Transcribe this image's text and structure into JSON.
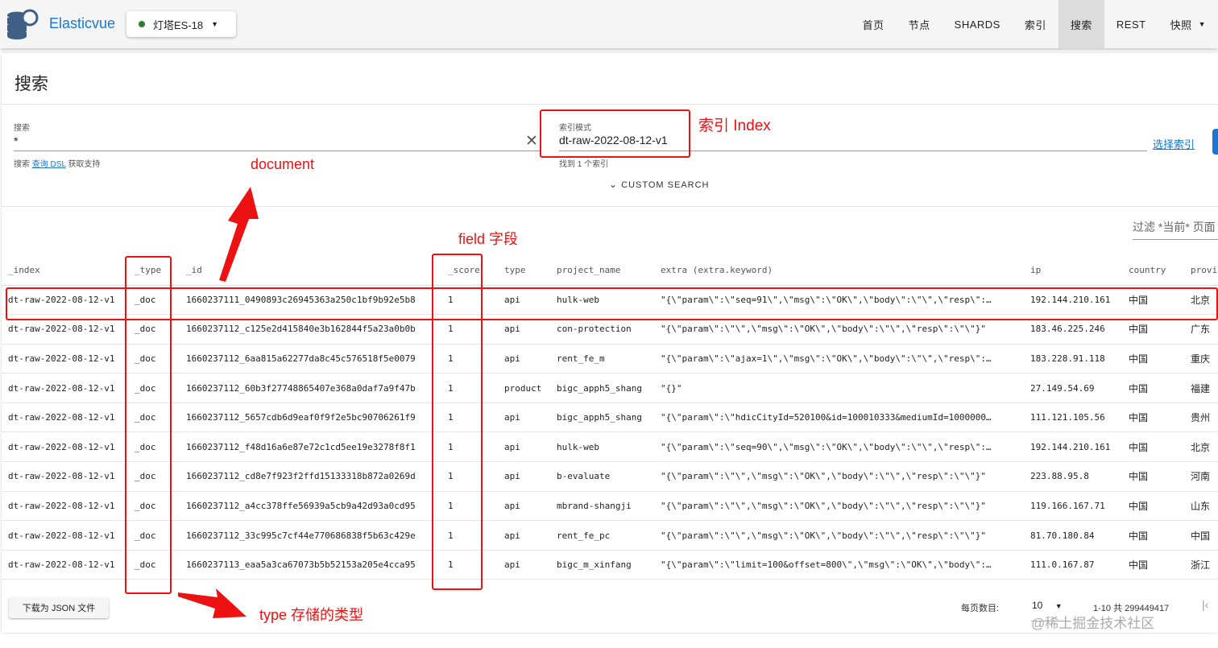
{
  "app": {
    "brand": "Elasticvue",
    "cluster": "灯塔ES-18"
  },
  "nav": [
    "首页",
    "节点",
    "SHARDS",
    "索引",
    "搜索",
    "REST",
    "快照"
  ],
  "page": {
    "title": "搜索"
  },
  "search": {
    "label": "搜索",
    "value": "*",
    "hint_prefix": "搜索",
    "hint_link": "查询 DSL",
    "hint_suffix": "获取支持",
    "index_label": "索引模式",
    "index_value": "dt-raw-2022-08-12-v1",
    "index_hint": "找到 1 个索引",
    "select_index": "选择索引",
    "custom_search": "CUSTOM SEARCH",
    "filter_placeholder": "过滤 *当前* 页面"
  },
  "table": {
    "columns": [
      "_index",
      "_type",
      "_id",
      "_score",
      "type",
      "project_name",
      "extra (extra.keyword)",
      "ip",
      "country",
      "province"
    ],
    "rows": [
      [
        "dt-raw-2022-08-12-v1",
        "_doc",
        "1660237111_0490893c26945363a250c1bf9b92e5b8",
        "1",
        "api",
        "hulk-web",
        "\"{\\\"param\\\":\\\"seq=91\\\",\\\"msg\\\":\\\"OK\\\",\\\"body\\\":\\\"\\\",\\\"resp\\\":…",
        "192.144.210.161",
        "中国",
        "北京"
      ],
      [
        "dt-raw-2022-08-12-v1",
        "_doc",
        "1660237112_c125e2d415840e3b162844f5a23a0b0b",
        "1",
        "api",
        "con-protection",
        "\"{\\\"param\\\":\\\"\\\",\\\"msg\\\":\\\"OK\\\",\\\"body\\\":\\\"\\\",\\\"resp\\\":\\\"\\\"}\"",
        "183.46.225.246",
        "中国",
        "广东"
      ],
      [
        "dt-raw-2022-08-12-v1",
        "_doc",
        "1660237112_6aa815a62277da8c45c576518f5e0079",
        "1",
        "api",
        "rent_fe_m",
        "\"{\\\"param\\\":\\\"ajax=1\\\",\\\"msg\\\":\\\"OK\\\",\\\"body\\\":\\\"\\\",\\\"resp\\\":…",
        "183.228.91.118",
        "中国",
        "重庆"
      ],
      [
        "dt-raw-2022-08-12-v1",
        "_doc",
        "1660237112_60b3f27748865407e368a0daf7a9f47b",
        "1",
        "product",
        "bigc_apph5_shang",
        "\"{}\"",
        "27.149.54.69",
        "中国",
        "福建"
      ],
      [
        "dt-raw-2022-08-12-v1",
        "_doc",
        "1660237112_5657cdb6d9eaf0f9f2e5bc90706261f9",
        "1",
        "api",
        "bigc_apph5_shang",
        "\"{\\\"param\\\":\\\"hdicCityId=520100&id=100010333&mediumId=1000000…",
        "111.121.105.56",
        "中国",
        "贵州"
      ],
      [
        "dt-raw-2022-08-12-v1",
        "_doc",
        "1660237112_f48d16a6e87e72c1cd5ee19e3278f8f1",
        "1",
        "api",
        "hulk-web",
        "\"{\\\"param\\\":\\\"seq=90\\\",\\\"msg\\\":\\\"OK\\\",\\\"body\\\":\\\"\\\",\\\"resp\\\":…",
        "192.144.210.161",
        "中国",
        "北京"
      ],
      [
        "dt-raw-2022-08-12-v1",
        "_doc",
        "1660237112_cd8e7f923f2ffd15133318b872a0269d",
        "1",
        "api",
        "b-evaluate",
        "\"{\\\"param\\\":\\\"\\\",\\\"msg\\\":\\\"OK\\\",\\\"body\\\":\\\"\\\",\\\"resp\\\":\\\"\\\"}\"",
        "223.88.95.8",
        "中国",
        "河南"
      ],
      [
        "dt-raw-2022-08-12-v1",
        "_doc",
        "1660237112_a4cc378ffe56939a5cb9a42d93a0cd95",
        "1",
        "api",
        "mbrand-shangji",
        "\"{\\\"param\\\":\\\"\\\",\\\"msg\\\":\\\"OK\\\",\\\"body\\\":\\\"\\\",\\\"resp\\\":\\\"\\\"}\"",
        "119.166.167.71",
        "中国",
        "山东"
      ],
      [
        "dt-raw-2022-08-12-v1",
        "_doc",
        "1660237112_33c995c7cf44e770686838f5b63c429e",
        "1",
        "api",
        "rent_fe_pc",
        "\"{\\\"param\\\":\\\"\\\",\\\"msg\\\":\\\"OK\\\",\\\"body\\\":\\\"\\\",\\\"resp\\\":\\\"\\\"}\"",
        "81.70.180.84",
        "中国",
        "中国"
      ],
      [
        "dt-raw-2022-08-12-v1",
        "_doc",
        "1660237113_eaa5a3ca67073b5b52153a205e4cca95",
        "1",
        "api",
        "bigc_m_xinfang",
        "\"{\\\"param\\\":\\\"limit=100&offset=800\\\",\\\"msg\\\":\\\"OK\\\",\\\"body\\\":…",
        "111.0.167.87",
        "中国",
        "浙江"
      ]
    ]
  },
  "footer": {
    "download": "下载为 JSON 文件",
    "per_page_label": "每页数目:",
    "per_page": "10",
    "range": "1-10 共 299449417"
  },
  "annotations": {
    "index": "索引 Index",
    "document": "document",
    "field": "field  字段",
    "type": "type 存储的类型",
    "color": "#ee1111"
  },
  "watermark": "@稀土掘金技术社区"
}
